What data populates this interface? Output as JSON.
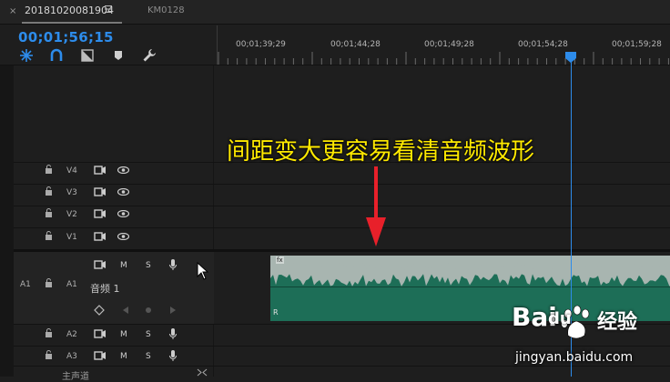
{
  "tabs": {
    "close_symbol": "×",
    "active_label": "20181020081904",
    "menu_symbol": "☰",
    "second_label": "KM0128"
  },
  "timecode": "00;01;56;15",
  "ruler": {
    "labels": [
      "00;01;39;29",
      "00;01;44;28",
      "00;01;49;28",
      "00;01;54;28",
      "00;01;59;28"
    ]
  },
  "tracks": {
    "video": [
      {
        "name": "V4"
      },
      {
        "name": "V3"
      },
      {
        "name": "V2"
      },
      {
        "name": "V1"
      }
    ],
    "audio": [
      {
        "source": "A1",
        "name": "A1",
        "title": "音频 1",
        "m": "M",
        "s": "S"
      },
      {
        "name": "A2",
        "m": "M",
        "s": "S"
      },
      {
        "name": "A3",
        "m": "M",
        "s": "S"
      }
    ],
    "master_label": "主声道"
  },
  "clip": {
    "left_marker": "R",
    "fx_badge": "fx"
  },
  "annotation": "间距变大更容易看清音频波形",
  "watermark": {
    "brand_bai": "Bai",
    "brand_du": "du",
    "brand_jy": "经验",
    "url": "jingyan.baidu.com"
  },
  "colors": {
    "accent": "#2d8ceb",
    "clip_green": "#1d6e57",
    "annotation_yellow": "#ffea00",
    "arrow_red": "#e8202a"
  }
}
